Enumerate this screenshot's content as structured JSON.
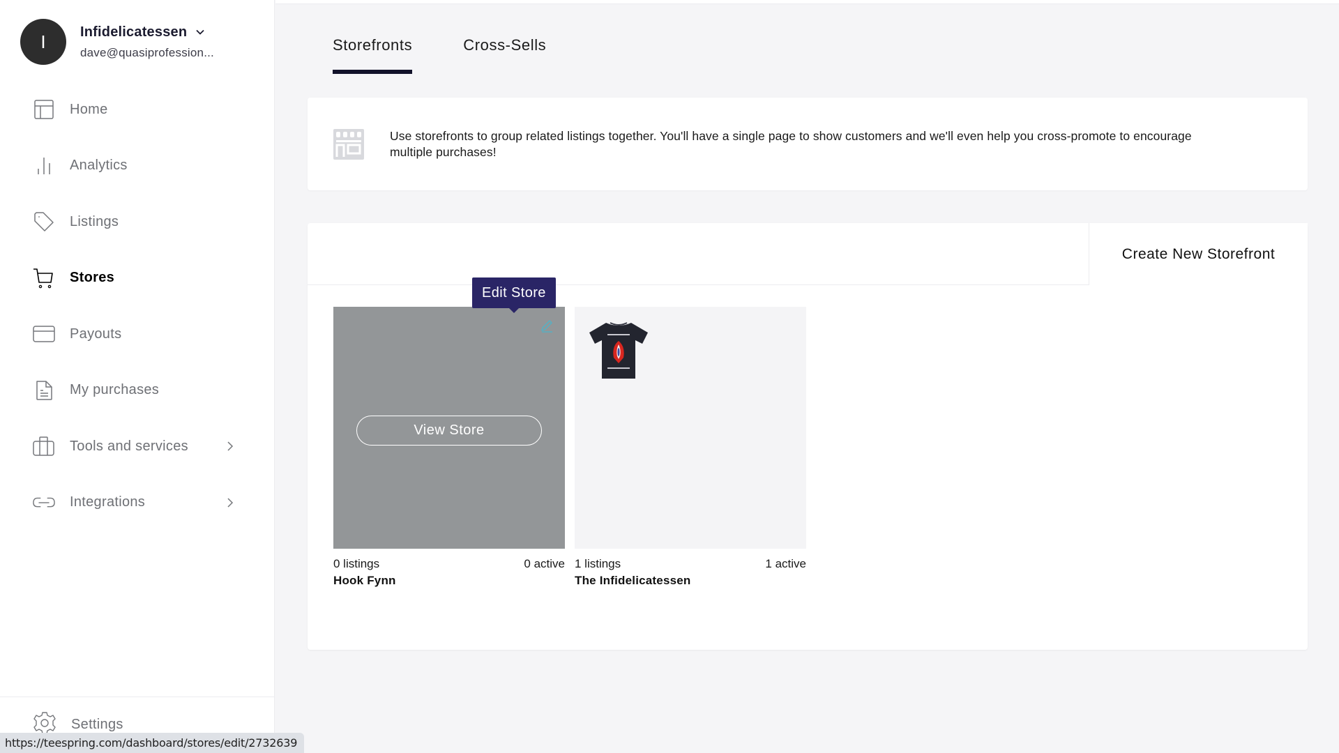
{
  "account": {
    "avatar_initial": "I",
    "name": "Infidelicatessen",
    "email": "dave@quasiprofession..."
  },
  "sidebar": {
    "items": [
      {
        "label": "Home",
        "icon": "layout-icon"
      },
      {
        "label": "Analytics",
        "icon": "bar-chart-icon"
      },
      {
        "label": "Listings",
        "icon": "tag-icon"
      },
      {
        "label": "Stores",
        "icon": "cart-icon",
        "active": true
      },
      {
        "label": "Payouts",
        "icon": "credit-card-icon"
      },
      {
        "label": "My purchases",
        "icon": "document-icon"
      },
      {
        "label": "Tools and services",
        "icon": "briefcase-icon",
        "has_submenu": true
      },
      {
        "label": "Integrations",
        "icon": "link-icon",
        "has_submenu": true
      }
    ],
    "settings_label": "Settings"
  },
  "tabs": [
    {
      "label": "Storefronts",
      "active": true
    },
    {
      "label": "Cross-Sells",
      "active": false
    }
  ],
  "info": {
    "text": "Use storefronts to group related listings together. You'll have a single page to show customers and we'll even help you cross-promote to encourage multiple purchases!"
  },
  "stores": {
    "create_label": "Create New Storefront",
    "tooltip": "Edit Store",
    "view_store_label": "View Store",
    "items": [
      {
        "name": "Hook Fynn",
        "listings": "0 listings",
        "active": "0 active"
      },
      {
        "name": "The Infidelicatessen",
        "listings": "1 listings",
        "active": "1 active"
      }
    ]
  },
  "status_bar": {
    "url": "https://teespring.com/dashboard/stores/edit/2732639"
  },
  "colors": {
    "tooltip_bg": "#2a2566",
    "tab_underline": "#12122a",
    "edit_icon": "#4fb3c8",
    "avatar_bg": "#2d2d2d"
  }
}
